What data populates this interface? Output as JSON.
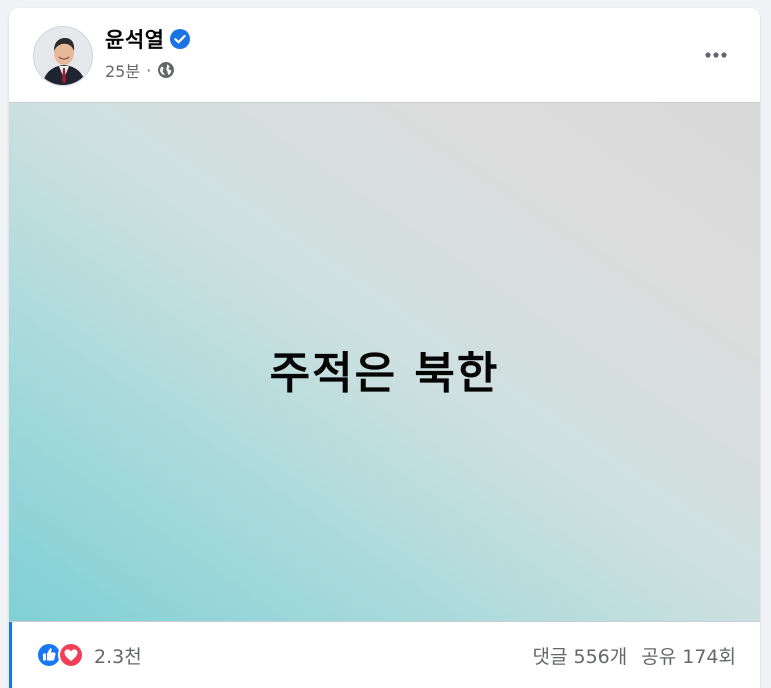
{
  "post": {
    "author": {
      "name": "윤석열",
      "verified_icon": "verified-badge-icon"
    },
    "meta": {
      "time": "25분",
      "separator": "·",
      "privacy_icon": "globe-icon"
    },
    "more_icon": "more-options-icon",
    "media": {
      "text": "주적은 북한"
    },
    "reactions": {
      "icons": [
        "like-icon",
        "love-icon"
      ],
      "count": "2.3천"
    },
    "stats": {
      "comments": "댓글 556개",
      "shares": "공유 174회"
    },
    "colors": {
      "verified": "#1b74e4",
      "like": "#1877f2",
      "love": "#f33e58",
      "meta_text": "#65676b"
    }
  }
}
